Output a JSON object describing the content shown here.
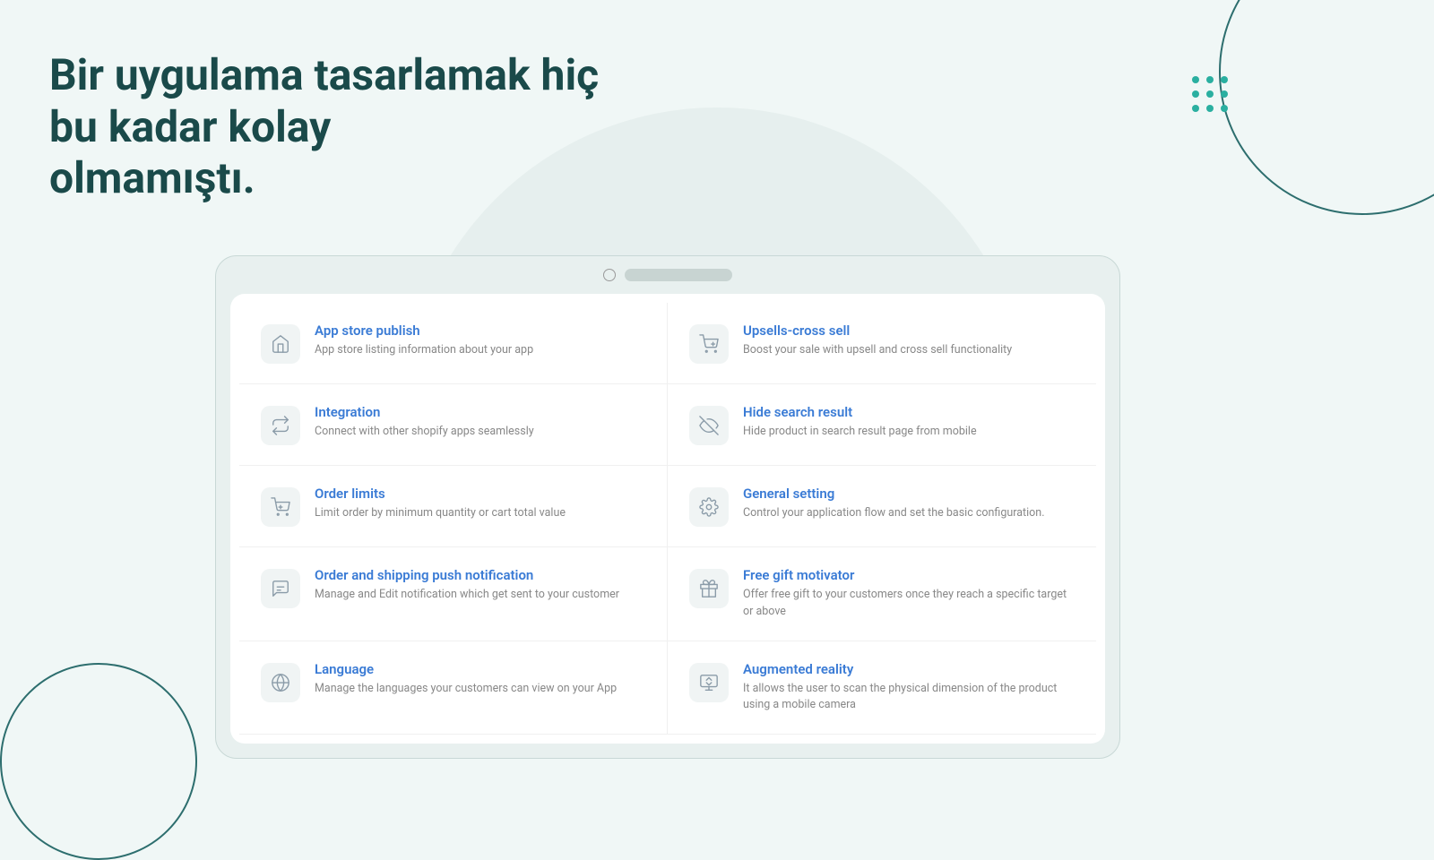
{
  "page": {
    "background_color": "#f0f7f6"
  },
  "headline": {
    "line1": "Bir uygulama tasarlamak hiç bu kadar kolay",
    "line2": "olmamıştı."
  },
  "device": {
    "top_bar": {
      "circle_label": "circle",
      "pill_label": "pill"
    }
  },
  "features": [
    {
      "id": "app-store-publish",
      "title": "App store publish",
      "description": "App store listing information about your app",
      "icon": "store"
    },
    {
      "id": "upsells-cross-sell",
      "title": "Upsells-cross sell",
      "description": "Boost your sale with upsell and cross sell functionality",
      "icon": "upsell"
    },
    {
      "id": "integration",
      "title": "Integration",
      "description": "Connect with other shopify apps seamlessly",
      "icon": "integration"
    },
    {
      "id": "hide-search-result",
      "title": "Hide search result",
      "description": "Hide product in search result page from mobile",
      "icon": "hide-search"
    },
    {
      "id": "order-limits",
      "title": "Order limits",
      "description": "Limit order by minimum quantity or cart total value",
      "icon": "order-limits"
    },
    {
      "id": "general-setting",
      "title": "General setting",
      "description": "Control your application flow and set the basic configuration.",
      "icon": "settings"
    },
    {
      "id": "order-shipping-notification",
      "title": "Order and shipping push notification",
      "description": "Manage and Edit notification which get sent to your customer",
      "icon": "notification"
    },
    {
      "id": "free-gift-motivator",
      "title": "Free gift motivator",
      "description": "Offer free gift to your customers once they reach a specific target or above",
      "icon": "gift"
    },
    {
      "id": "language",
      "title": "Language",
      "description": "Manage the languages your customers can view on your App",
      "icon": "language"
    },
    {
      "id": "augmented-reality",
      "title": "Augmented reality",
      "description": "It allows the user to scan the physical dimension of the product using a mobile camera",
      "icon": "ar"
    }
  ],
  "dots": {
    "count": 9,
    "color": "#2aafa0"
  }
}
